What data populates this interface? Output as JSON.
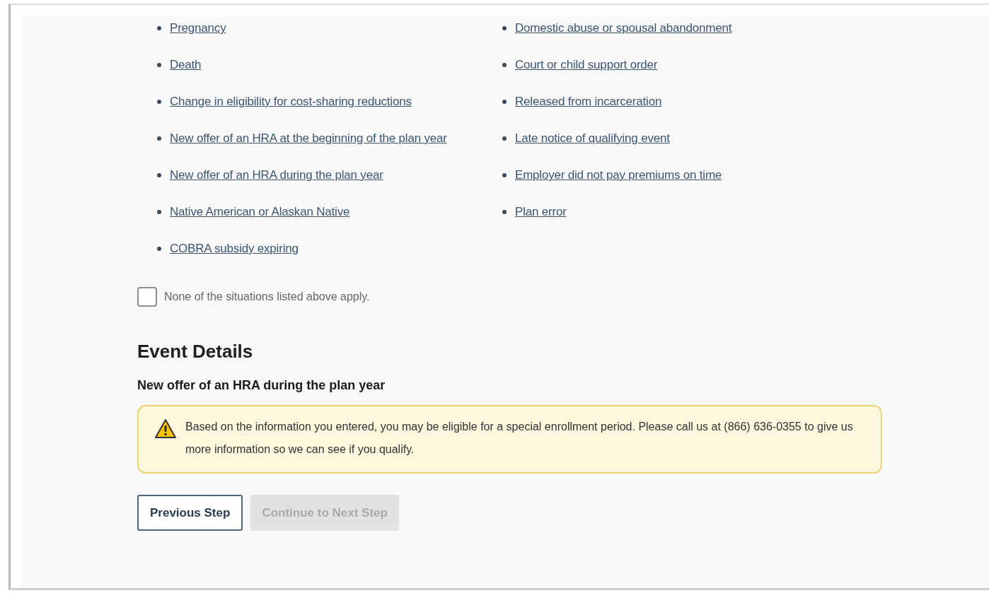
{
  "events": {
    "columns": [
      [
        "Pregnancy",
        "Death",
        "Change in eligibility for cost-sharing reductions",
        "New offer of an HRA at the beginning of the plan year",
        "New offer of an HRA during the plan year",
        "Native American or Alaskan Native",
        "COBRA subsidy expiring"
      ],
      [
        "Domestic abuse or spousal abandonment",
        "Court or child support order",
        "Released from incarceration",
        "Late notice of qualifying event",
        "Employer did not pay premiums on time",
        "Plan error"
      ]
    ]
  },
  "none_option": {
    "label": "None of the situations listed above apply.",
    "checked": false
  },
  "event_details": {
    "heading": "Event Details",
    "event_name": "New offer of an HRA during the plan year",
    "alert": {
      "kind": "warning",
      "text": "Based on the information you entered, you may be eligible for a special enrollment period. Please call us at (866) 636-0355 to give us more information so we can see if you qualify."
    }
  },
  "buttons": [
    {
      "label": "Previous Step",
      "disabled": false,
      "kind": "secondary"
    },
    {
      "label": "Continue to Next Step",
      "disabled": true,
      "kind": "primary"
    }
  ]
}
